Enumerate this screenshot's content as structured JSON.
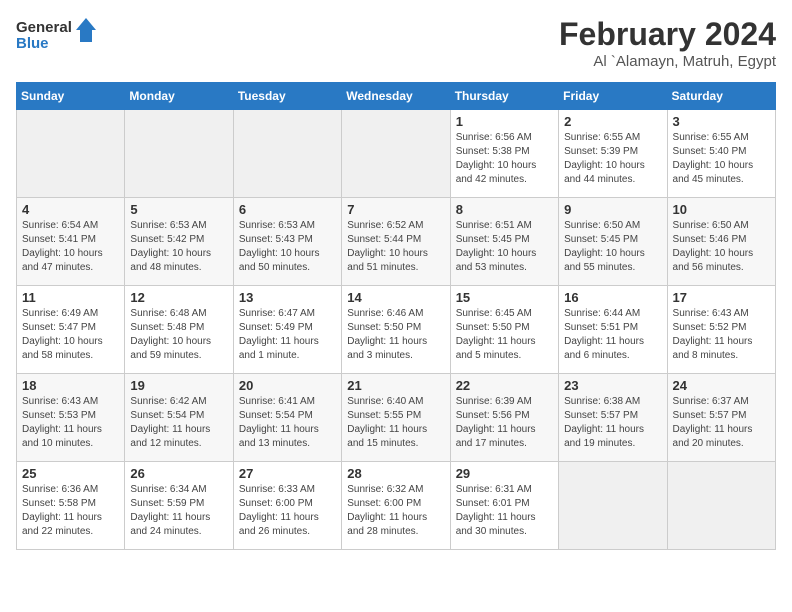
{
  "logo": {
    "line1": "General",
    "line2": "Blue"
  },
  "title": "February 2024",
  "subtitle": "Al `Alamayn, Matruh, Egypt",
  "days_of_week": [
    "Sunday",
    "Monday",
    "Tuesday",
    "Wednesday",
    "Thursday",
    "Friday",
    "Saturday"
  ],
  "weeks": [
    [
      {
        "day": "",
        "info": ""
      },
      {
        "day": "",
        "info": ""
      },
      {
        "day": "",
        "info": ""
      },
      {
        "day": "",
        "info": ""
      },
      {
        "day": "1",
        "info": "Sunrise: 6:56 AM\nSunset: 5:38 PM\nDaylight: 10 hours\nand 42 minutes."
      },
      {
        "day": "2",
        "info": "Sunrise: 6:55 AM\nSunset: 5:39 PM\nDaylight: 10 hours\nand 44 minutes."
      },
      {
        "day": "3",
        "info": "Sunrise: 6:55 AM\nSunset: 5:40 PM\nDaylight: 10 hours\nand 45 minutes."
      }
    ],
    [
      {
        "day": "4",
        "info": "Sunrise: 6:54 AM\nSunset: 5:41 PM\nDaylight: 10 hours\nand 47 minutes."
      },
      {
        "day": "5",
        "info": "Sunrise: 6:53 AM\nSunset: 5:42 PM\nDaylight: 10 hours\nand 48 minutes."
      },
      {
        "day": "6",
        "info": "Sunrise: 6:53 AM\nSunset: 5:43 PM\nDaylight: 10 hours\nand 50 minutes."
      },
      {
        "day": "7",
        "info": "Sunrise: 6:52 AM\nSunset: 5:44 PM\nDaylight: 10 hours\nand 51 minutes."
      },
      {
        "day": "8",
        "info": "Sunrise: 6:51 AM\nSunset: 5:45 PM\nDaylight: 10 hours\nand 53 minutes."
      },
      {
        "day": "9",
        "info": "Sunrise: 6:50 AM\nSunset: 5:45 PM\nDaylight: 10 hours\nand 55 minutes."
      },
      {
        "day": "10",
        "info": "Sunrise: 6:50 AM\nSunset: 5:46 PM\nDaylight: 10 hours\nand 56 minutes."
      }
    ],
    [
      {
        "day": "11",
        "info": "Sunrise: 6:49 AM\nSunset: 5:47 PM\nDaylight: 10 hours\nand 58 minutes."
      },
      {
        "day": "12",
        "info": "Sunrise: 6:48 AM\nSunset: 5:48 PM\nDaylight: 10 hours\nand 59 minutes."
      },
      {
        "day": "13",
        "info": "Sunrise: 6:47 AM\nSunset: 5:49 PM\nDaylight: 11 hours\nand 1 minute."
      },
      {
        "day": "14",
        "info": "Sunrise: 6:46 AM\nSunset: 5:50 PM\nDaylight: 11 hours\nand 3 minutes."
      },
      {
        "day": "15",
        "info": "Sunrise: 6:45 AM\nSunset: 5:50 PM\nDaylight: 11 hours\nand 5 minutes."
      },
      {
        "day": "16",
        "info": "Sunrise: 6:44 AM\nSunset: 5:51 PM\nDaylight: 11 hours\nand 6 minutes."
      },
      {
        "day": "17",
        "info": "Sunrise: 6:43 AM\nSunset: 5:52 PM\nDaylight: 11 hours\nand 8 minutes."
      }
    ],
    [
      {
        "day": "18",
        "info": "Sunrise: 6:43 AM\nSunset: 5:53 PM\nDaylight: 11 hours\nand 10 minutes."
      },
      {
        "day": "19",
        "info": "Sunrise: 6:42 AM\nSunset: 5:54 PM\nDaylight: 11 hours\nand 12 minutes."
      },
      {
        "day": "20",
        "info": "Sunrise: 6:41 AM\nSunset: 5:54 PM\nDaylight: 11 hours\nand 13 minutes."
      },
      {
        "day": "21",
        "info": "Sunrise: 6:40 AM\nSunset: 5:55 PM\nDaylight: 11 hours\nand 15 minutes."
      },
      {
        "day": "22",
        "info": "Sunrise: 6:39 AM\nSunset: 5:56 PM\nDaylight: 11 hours\nand 17 minutes."
      },
      {
        "day": "23",
        "info": "Sunrise: 6:38 AM\nSunset: 5:57 PM\nDaylight: 11 hours\nand 19 minutes."
      },
      {
        "day": "24",
        "info": "Sunrise: 6:37 AM\nSunset: 5:57 PM\nDaylight: 11 hours\nand 20 minutes."
      }
    ],
    [
      {
        "day": "25",
        "info": "Sunrise: 6:36 AM\nSunset: 5:58 PM\nDaylight: 11 hours\nand 22 minutes."
      },
      {
        "day": "26",
        "info": "Sunrise: 6:34 AM\nSunset: 5:59 PM\nDaylight: 11 hours\nand 24 minutes."
      },
      {
        "day": "27",
        "info": "Sunrise: 6:33 AM\nSunset: 6:00 PM\nDaylight: 11 hours\nand 26 minutes."
      },
      {
        "day": "28",
        "info": "Sunrise: 6:32 AM\nSunset: 6:00 PM\nDaylight: 11 hours\nand 28 minutes."
      },
      {
        "day": "29",
        "info": "Sunrise: 6:31 AM\nSunset: 6:01 PM\nDaylight: 11 hours\nand 30 minutes."
      },
      {
        "day": "",
        "info": ""
      },
      {
        "day": "",
        "info": ""
      }
    ]
  ]
}
